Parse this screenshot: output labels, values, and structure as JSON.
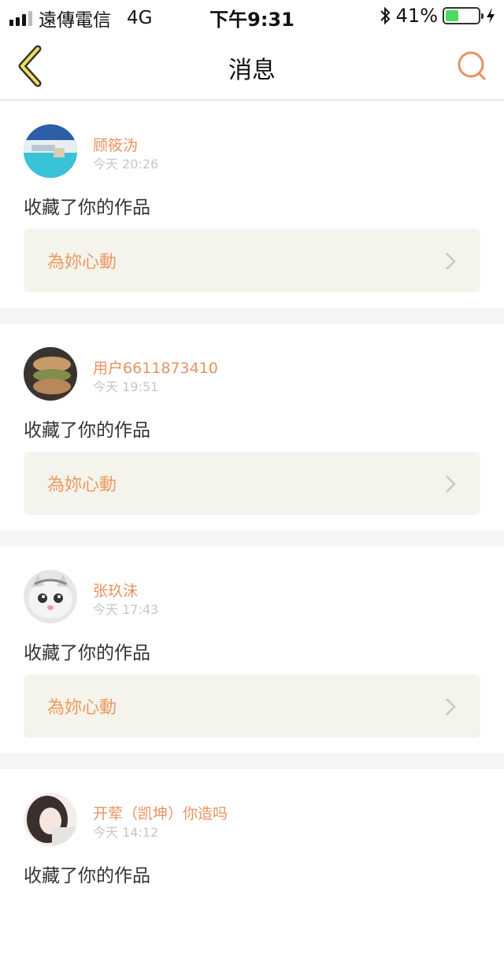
{
  "status_bar": {
    "carrier": "遠傳電信",
    "network": "4G",
    "time": "下午9:31",
    "battery": "41%",
    "battery_level": 0.41
  },
  "nav": {
    "title": "消息",
    "back_icon": "chevron-left-icon",
    "search_icon": "search-icon",
    "accent_color": "#e9925e"
  },
  "notifications": [
    {
      "user": "顾筱沩",
      "time": "今天 20:26",
      "action": "收藏了你的作品",
      "work_title": "為妳心動",
      "avatar": "pool-photo"
    },
    {
      "user": "用户6611873410",
      "time": "今天 19:51",
      "action": "收藏了你的作品",
      "work_title": "為妳心動",
      "avatar": "food-photo"
    },
    {
      "user": "张玖沬",
      "time": "今天 17:43",
      "action": "收藏了你的作品",
      "work_title": "為妳心動",
      "avatar": "cat-photo"
    },
    {
      "user": "开荤（凯坤）你造吗",
      "time": "今天 14:12",
      "action": "收藏了你的作品",
      "work_title": "",
      "avatar": "girl-photo"
    }
  ]
}
